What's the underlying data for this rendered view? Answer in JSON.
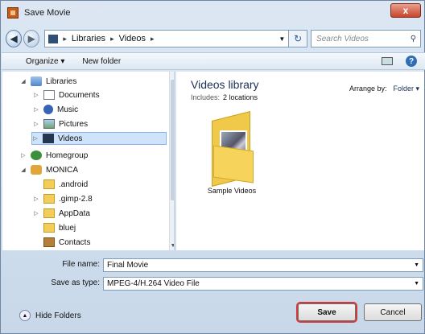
{
  "window": {
    "title": "Save Movie",
    "close_glyph": "x"
  },
  "address": {
    "crumbs": [
      "Libraries",
      "Videos"
    ],
    "refresh_glyph": "↻",
    "search_placeholder": "Search Videos"
  },
  "toolbar": {
    "organize": "Organize ▾",
    "new_folder": "New folder"
  },
  "nav": {
    "items": [
      {
        "label": "Libraries",
        "icon": "library-icon"
      },
      {
        "label": "Documents",
        "icon": "documents-icon"
      },
      {
        "label": "Music",
        "icon": "music-icon"
      },
      {
        "label": "Pictures",
        "icon": "pictures-icon"
      },
      {
        "label": "Videos",
        "icon": "videos-icon"
      },
      {
        "label": "Homegroup",
        "icon": "homegroup-icon"
      },
      {
        "label": "MONICA",
        "icon": "user-folder-icon"
      },
      {
        "label": ".android",
        "icon": "folder-icon"
      },
      {
        "label": ".gimp-2.8",
        "icon": "folder-icon"
      },
      {
        "label": "AppData",
        "icon": "folder-icon"
      },
      {
        "label": "bluej",
        "icon": "folder-icon"
      },
      {
        "label": "Contacts",
        "icon": "contacts-icon"
      }
    ]
  },
  "content": {
    "library_title": "Videos library",
    "includes_label": "Includes:",
    "includes_value": "2 locations",
    "arrange_label": "Arrange by:",
    "arrange_value": "Folder ▾",
    "items": [
      {
        "label": "Sample Videos"
      }
    ]
  },
  "form": {
    "file_name_label": "File name:",
    "file_name_value": "Final Movie",
    "save_type_label": "Save as type:",
    "save_type_value": "MPEG-4/H.264 Video File"
  },
  "footer": {
    "hide_folders": "Hide Folders",
    "save": "Save",
    "cancel": "Cancel"
  }
}
